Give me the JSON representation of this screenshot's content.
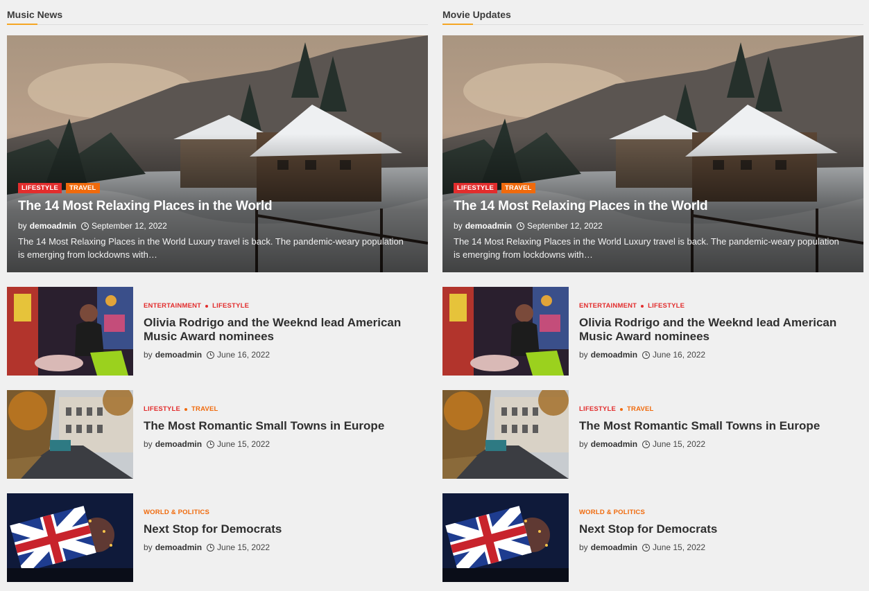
{
  "colors": {
    "accent_underline": "#f5a623",
    "lifestyle": "#e22d2d",
    "travel": "#f06a0c",
    "entertainment": "#e22d2d",
    "world_politics": "#f06a0c"
  },
  "sections": [
    {
      "title": "Music News",
      "hero": {
        "categories": [
          "LIFESTYLE",
          "TRAVEL"
        ],
        "title": "The 14 Most Relaxing Places in the World",
        "by": "by",
        "author": "demoadmin",
        "date": "September 12, 2022",
        "excerpt": "The 14 Most Relaxing Places in the World Luxury travel is back. The pandemic-weary population is emerging from lockdowns with…"
      },
      "posts": [
        {
          "cat1": "ENTERTAINMENT",
          "cat2": "LIFESTYLE",
          "title": "Olivia Rodrigo and the Weeknd lead American Music Award nominees",
          "by": "by",
          "author": "demoadmin",
          "date": "June 16, 2022"
        },
        {
          "cat1": "LIFESTYLE",
          "cat2": "TRAVEL",
          "title": "The Most Romantic Small Towns in Europe",
          "by": "by",
          "author": "demoadmin",
          "date": "June 15, 2022"
        },
        {
          "cat1": "WORLD & POLITICS",
          "title": "Next Stop for Democrats",
          "by": "by",
          "author": "demoadmin",
          "date": "June 15, 2022"
        }
      ]
    },
    {
      "title": "Movie Updates",
      "hero": {
        "categories": [
          "LIFESTYLE",
          "TRAVEL"
        ],
        "title": "The 14 Most Relaxing Places in the World",
        "by": "by",
        "author": "demoadmin",
        "date": "September 12, 2022",
        "excerpt": "The 14 Most Relaxing Places in the World Luxury travel is back. The pandemic-weary population is emerging from lockdowns with…"
      },
      "posts": [
        {
          "cat1": "ENTERTAINMENT",
          "cat2": "LIFESTYLE",
          "title": "Olivia Rodrigo and the Weeknd lead American Music Award nominees",
          "by": "by",
          "author": "demoadmin",
          "date": "June 16, 2022"
        },
        {
          "cat1": "LIFESTYLE",
          "cat2": "TRAVEL",
          "title": "The Most Romantic Small Towns in Europe",
          "by": "by",
          "author": "demoadmin",
          "date": "June 15, 2022"
        },
        {
          "cat1": "WORLD & POLITICS",
          "title": "Next Stop for Democrats",
          "by": "by",
          "author": "demoadmin",
          "date": "June 15, 2022"
        }
      ]
    }
  ]
}
